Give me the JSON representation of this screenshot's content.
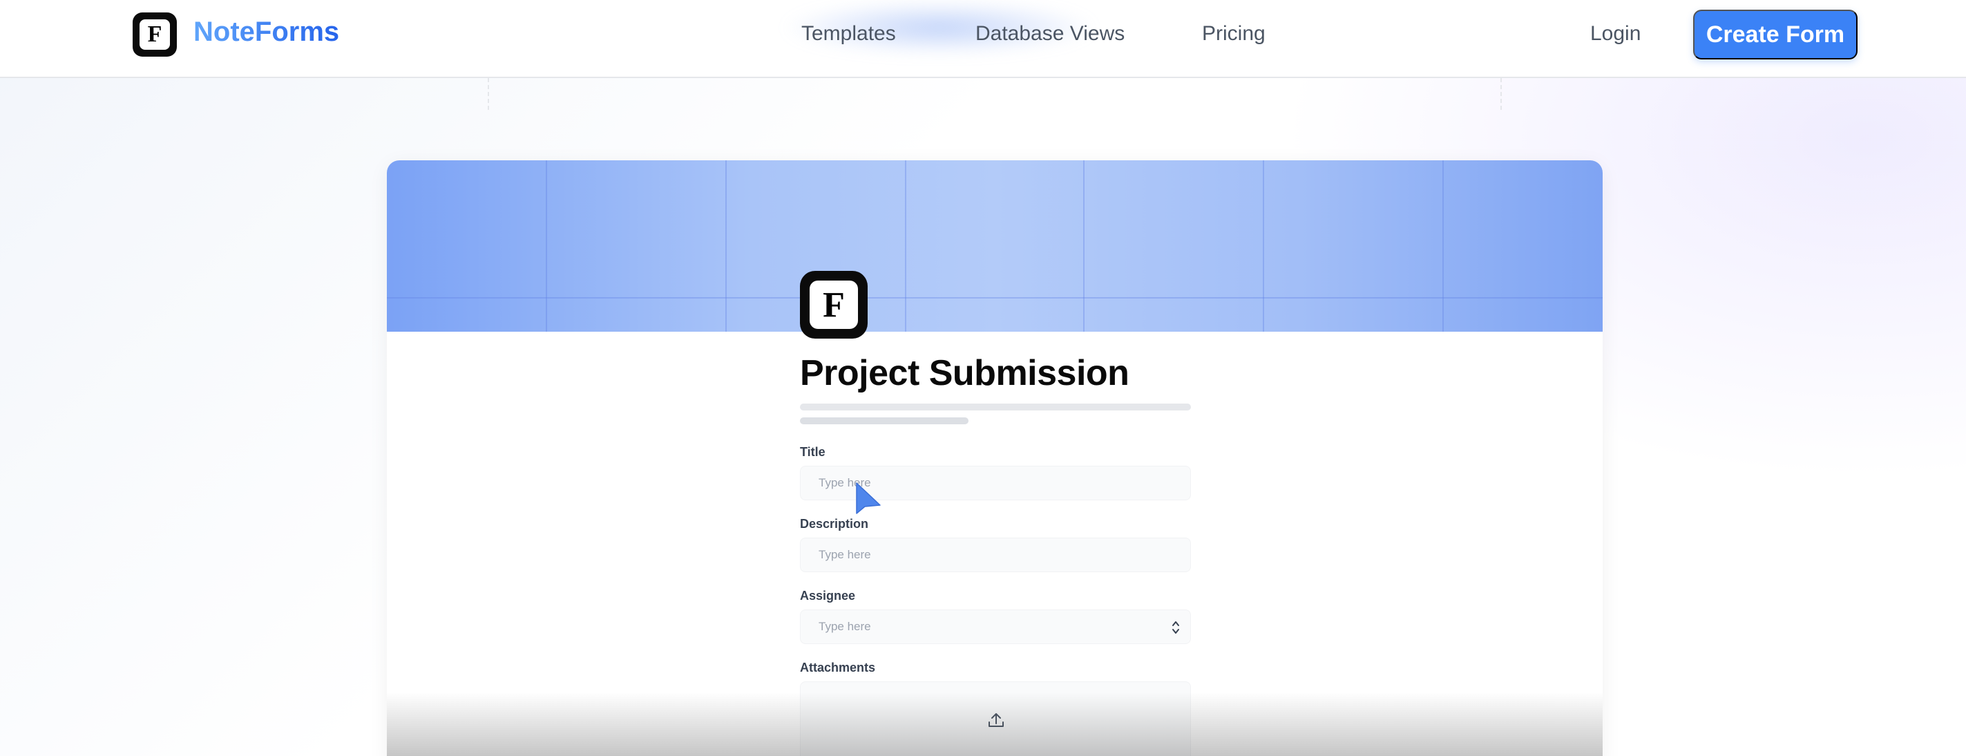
{
  "nav": {
    "brand": "NoteForms",
    "logo_letter": "F",
    "links": [
      "Templates",
      "Database Views",
      "Pricing"
    ],
    "login": "Login",
    "cta": "Create Form"
  },
  "form": {
    "logo_letter": "F",
    "title": "Project Submission",
    "fields": [
      {
        "label": "Title",
        "placeholder": "Type here",
        "type": "text"
      },
      {
        "label": "Description",
        "placeholder": "Type here",
        "type": "text"
      },
      {
        "label": "Assignee",
        "placeholder": "Type here",
        "type": "select"
      },
      {
        "label": "Attachments",
        "type": "file"
      }
    ]
  },
  "colors": {
    "accent": "#3b82f6",
    "brand_gradient_start": "#60a5fa",
    "brand_gradient_end": "#2563eb",
    "cover_blue": "#a9c4f8"
  },
  "icons": {
    "select": "chevron-up-down-icon",
    "upload": "upload-icon",
    "cursor": "mouse-pointer-icon"
  }
}
